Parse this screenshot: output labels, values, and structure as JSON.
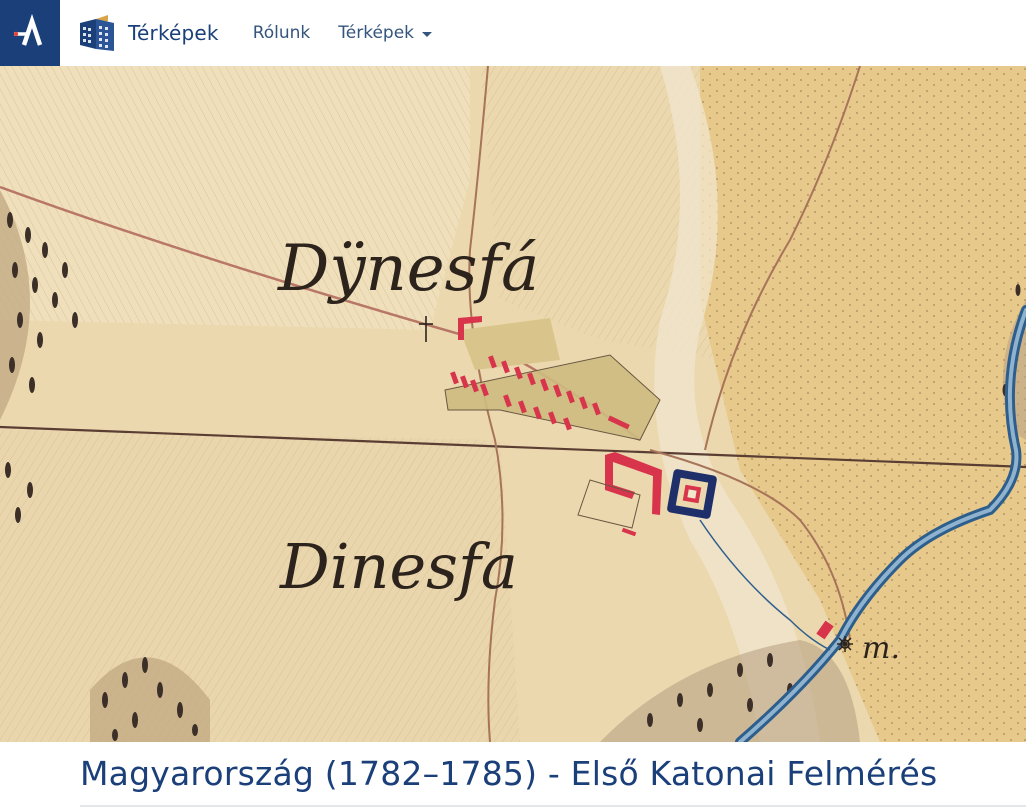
{
  "navbar": {
    "brand_text": "Térképek",
    "links": [
      {
        "label": "Rólunk"
      },
      {
        "label": "Térképek",
        "dropdown": true
      }
    ]
  },
  "map": {
    "labels": [
      "Dÿnesfá",
      "Dinesfa",
      "m."
    ]
  },
  "page": {
    "title": "Magyarország (1782–1785) - Első Katonai Felmérés"
  },
  "colors": {
    "brand_blue": "#1a3f79",
    "nav_link": "#34557c",
    "parchment": "#e9d3a6",
    "buildings": "#d8344c"
  },
  "icons": {
    "brand_mark": "arcanum-a-logo",
    "site_logo": "map-stack-icon",
    "dropdown": "caret-down-icon",
    "church": "cross-icon",
    "mill": "mill-wheel-icon"
  }
}
